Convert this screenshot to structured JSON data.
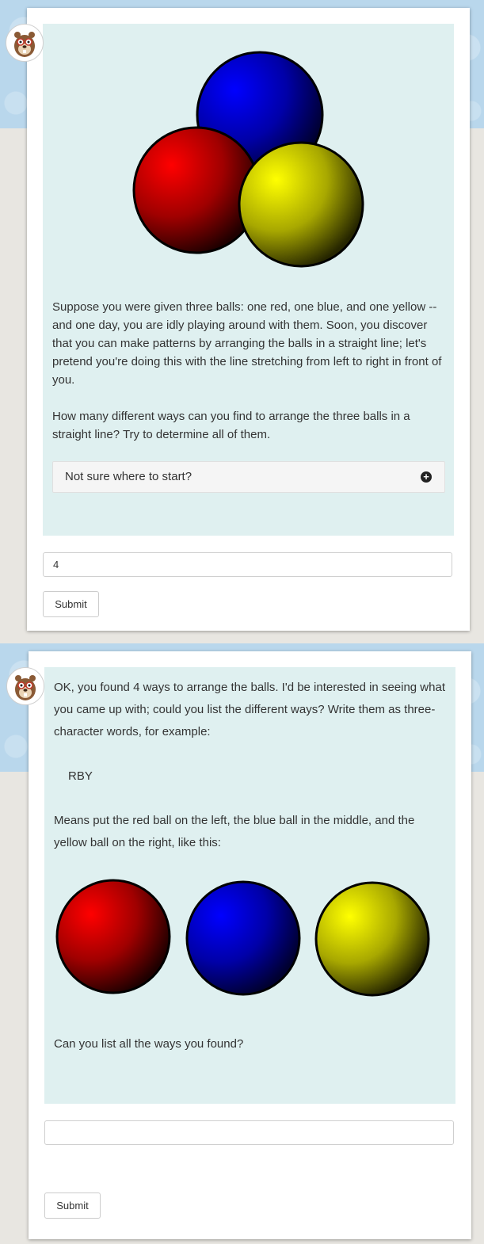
{
  "step1": {
    "question_paragraphs": [
      "Suppose you were given three balls: one red, one blue, and one yellow -- and one day, you are idly playing around with them. Soon, you discover that you can make patterns by arranging the balls in a straight line; let's pretend you're doing this with the line stretching from left to right in front of you.",
      "How many different ways can you find to arrange the three balls in a straight line? Try to determine all of them."
    ],
    "hint_label": "Not sure where to start?",
    "hint_icon": "plus-circle-icon",
    "answer_value": "4",
    "submit_label": "Submit"
  },
  "step2": {
    "paragraph1": "OK, you found 4 ways to arrange the balls. I'd be interested in seeing what you came up with; could you list the different ways? Write them as three-character words, for example:",
    "example": "RBY",
    "paragraph2": "Means put the red ball on the left, the blue ball in the middle, and the yellow ball on the right, like this:",
    "paragraph3": "Can you list all the ways you found?",
    "answer_value": "",
    "submit_label": "Submit"
  },
  "colors": {
    "red_ball": "#ff0000",
    "blue_ball": "#0000ff",
    "yellow_ball": "#ffff00",
    "panel": "#dff0f0",
    "band": "#b9d7ec"
  }
}
